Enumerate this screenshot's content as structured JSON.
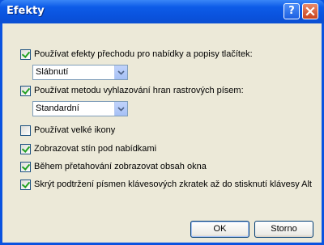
{
  "window": {
    "title": "Efekty"
  },
  "titlebar": {
    "help_icon": "question-mark",
    "close_icon": "close-x"
  },
  "options": [
    {
      "label": "Používat efekty přechodu pro nabídky a popisy tlačítek:",
      "checked": true
    },
    {
      "label": "Používat metodu vyhlazování hran rastrových písem:",
      "checked": true
    },
    {
      "label": "Používat velké ikony",
      "checked": false
    },
    {
      "label": "Zobrazovat stín pod nabídkami",
      "checked": true
    },
    {
      "label": "Během přetahování zobrazovat obsah okna",
      "checked": true
    },
    {
      "label": "Skrýt podtržení písmen klávesových zkratek až do stisknutí klávesy Alt",
      "checked": true
    }
  ],
  "transition_effect": {
    "selected": "Slábnutí"
  },
  "smoothing_method": {
    "selected": "Standardní"
  },
  "buttons": {
    "ok": "OK",
    "cancel": "Storno"
  }
}
